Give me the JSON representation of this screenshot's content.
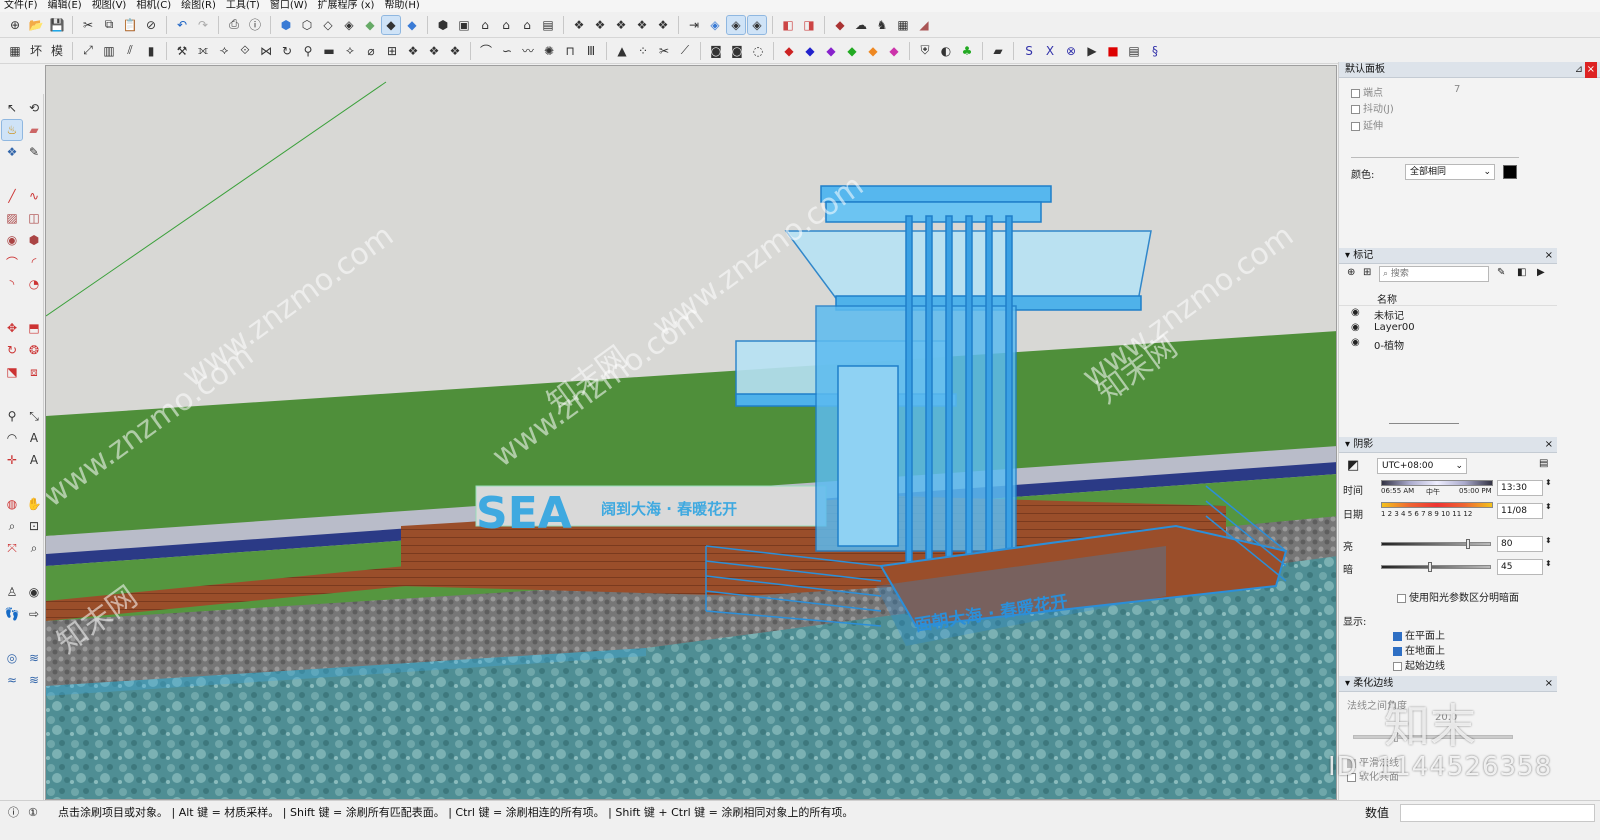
{
  "menu": [
    "文件(F)",
    "编辑(E)",
    "视图(V)",
    "相机(C)",
    "绘图(R)",
    "工具(T)",
    "窗口(W)",
    "扩展程序 (x)",
    "帮助(H)"
  ],
  "scene": {
    "sign_brand": "SEA",
    "sign_text": "阔到大海 · 春暖花开",
    "dock_sign": "面朝大海 · 春暖花开",
    "watermark": "www.znzmo.com",
    "watermark_cn": "知末网",
    "logo": "知末",
    "id_text": "ID: 1144526358"
  },
  "default_panel": {
    "title": "默认面板",
    "endpoint_label": "端点",
    "endpoint_value": "7",
    "jitter_label": "抖动(J)",
    "extension_label": "延伸",
    "color_label": "颜色:",
    "color_value": "全部相同",
    "color_swatch": "#000000"
  },
  "tags_panel": {
    "title": "标记",
    "search_placeholder": "搜索",
    "column_name": "名称",
    "items": [
      "未标记",
      "Layer00",
      "0-植物"
    ]
  },
  "shadow_panel": {
    "title": "阴影",
    "timezone": "UTC+08:00",
    "time_label": "时间",
    "time_start": "06:55 AM",
    "time_noon": "中午",
    "time_end": "05:00 PM",
    "time_value": "13:30",
    "date_label": "日期",
    "months": "1 2 3 4 5 6 7 8 9 10 11 12",
    "date_value": "11/08",
    "light_label": "亮",
    "light_value": "80",
    "dark_label": "暗",
    "dark_value": "45",
    "use_sun_label": "使用阳光参数区分明暗面",
    "display_label": "显示:",
    "on_faces_label": "在平面上",
    "on_ground_label": "在地面上",
    "from_edges_label": "起始边线"
  },
  "soften_panel": {
    "title": "柔化边线",
    "angle_label": "法线之间角度",
    "angle_value": "20.0",
    "smooth_label": "平滑法线",
    "soften_label": "软化共面"
  },
  "status": {
    "message": "点击涂刷项目或对象。 | Alt 键 = 材质采样。 | Shift 键 = 涂刷所有匹配表面。 | Ctrl 键 = 涂刷相连的所有项。 | Shift 键 + Ctrl 键 = 涂刷相同对象上的所有项。",
    "value_label": "数值"
  }
}
